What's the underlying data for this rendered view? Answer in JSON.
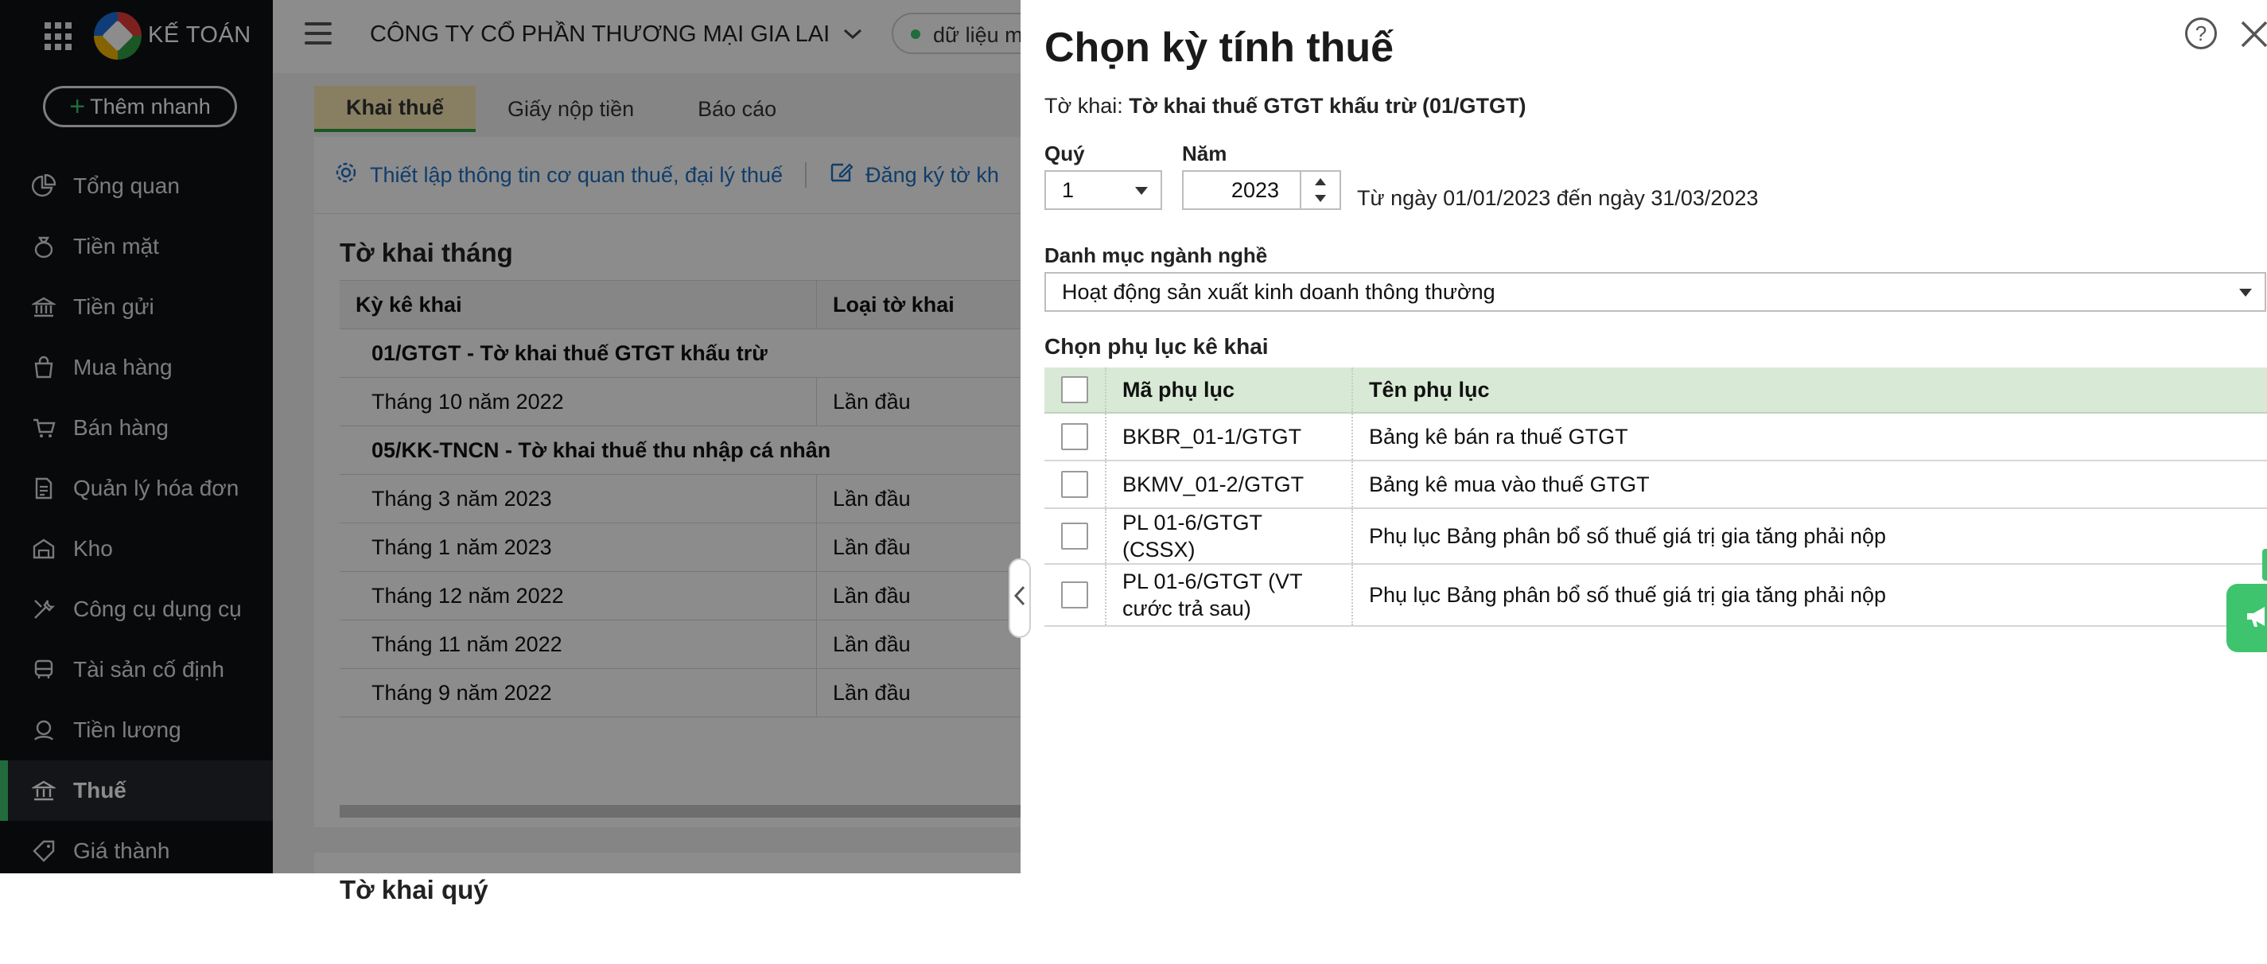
{
  "sidebar": {
    "app_name": "KẾ TOÁN",
    "quick_add_label": "Thêm nhanh",
    "items": [
      {
        "label": "Tổng quan",
        "icon": "chart-pie-icon"
      },
      {
        "label": "Tiền mặt",
        "icon": "money-bag-icon"
      },
      {
        "label": "Tiền gửi",
        "icon": "bank-icon"
      },
      {
        "label": "Mua hàng",
        "icon": "shopping-bag-icon"
      },
      {
        "label": "Bán hàng",
        "icon": "cart-icon"
      },
      {
        "label": "Quản lý hóa đơn",
        "icon": "invoice-icon"
      },
      {
        "label": "Kho",
        "icon": "warehouse-icon"
      },
      {
        "label": "Công cụ dụng cụ",
        "icon": "tools-icon"
      },
      {
        "label": "Tài sản cố định",
        "icon": "vehicle-icon"
      },
      {
        "label": "Tiền lương",
        "icon": "salary-icon"
      },
      {
        "label": "Thuế",
        "icon": "tax-icon",
        "active": true
      },
      {
        "label": "Giá thành",
        "icon": "price-tag-icon"
      }
    ]
  },
  "header": {
    "company": "CÔNG TY CỔ PHẦN THƯƠNG MẠI GIA LAI",
    "data_pill": "dữ liệu m"
  },
  "main": {
    "tabs": [
      "Khai thuế",
      "Giấy nộp tiền",
      "Báo cáo"
    ],
    "toolbar": {
      "setup_link": "Thiết lập thông tin cơ quan thuế, đại lý thuế",
      "register_link": "Đăng ký tờ kh"
    },
    "monthly": {
      "title": "Tờ khai tháng",
      "columns": [
        "Kỳ kê khai",
        "Loại tờ khai"
      ],
      "rows": [
        {
          "type": "group",
          "c1": "01/GTGT - Tờ khai thuế GTGT khấu trừ"
        },
        {
          "c1": "Tháng 10 năm 2022",
          "c2": "Lần đầu"
        },
        {
          "type": "group",
          "c1": "05/KK-TNCN - Tờ khai thuế thu nhập cá nhân"
        },
        {
          "c1": "Tháng 3 năm 2023",
          "c2": "Lần đầu"
        },
        {
          "c1": "Tháng 1 năm 2023",
          "c2": "Lần đầu"
        },
        {
          "c1": "Tháng 12 năm 2022",
          "c2": "Lần đầu"
        },
        {
          "c1": "Tháng 11 năm 2022",
          "c2": "Lần đầu"
        },
        {
          "c1": "Tháng 9 năm 2022",
          "c2": "Lần đầu"
        }
      ]
    },
    "quarterly_title": "Tờ khai quý"
  },
  "dialog": {
    "title": "Chọn kỳ tính thuế",
    "declaration_prefix": "Tờ khai:",
    "declaration_name": "Tờ khai thuế GTGT khấu trừ (01/GTGT)",
    "quarter_label": "Quý",
    "quarter_value": "1",
    "year_label": "Năm",
    "year_value": "2023",
    "date_range": "Từ ngày 01/01/2023 đến ngày 31/03/2023",
    "industry_label": "Danh mục ngành nghề",
    "industry_value": "Hoạt động sản xuất kinh doanh thông thường",
    "appendix_label": "Chọn phụ lục kê khai",
    "appendix_columns": [
      "Mã phụ lục",
      "Tên phụ lục"
    ],
    "appendix_rows": [
      {
        "code": "BKBR_01-1/GTGT",
        "name": "Bảng kê bán ra thuế GTGT"
      },
      {
        "code": "BKMV_01-2/GTGT",
        "name": "Bảng kê mua vào thuế GTGT"
      },
      {
        "code": "PL 01-6/GTGT (CSSX)",
        "name": "Phụ lục Bảng phân bổ số thuế giá trị gia tăng phải nộp"
      },
      {
        "code": "PL 01-6/GTGT (VT cước trả sau)",
        "name": "Phụ lục Bảng phân bổ số thuế giá trị gia tăng phải nộp"
      }
    ]
  },
  "colors": {
    "accent_green": "#3ec46d",
    "sidebar_bg": "#0f1115",
    "link_blue": "#1d6fc4",
    "table_header_green": "#d8ead5"
  }
}
